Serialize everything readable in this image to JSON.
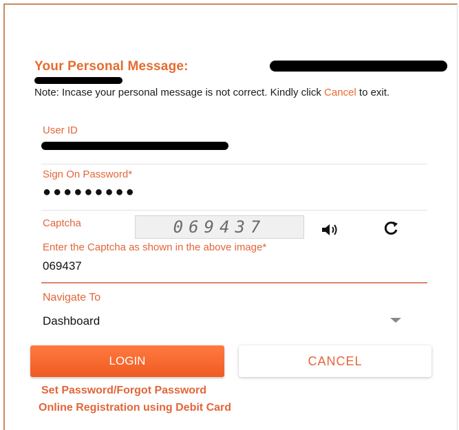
{
  "message": {
    "title": "Your Personal Message:",
    "note_prefix": "Note: Incase your personal message is not correct. Kindly click ",
    "note_cancel": "Cancel",
    "note_suffix": " to exit."
  },
  "form": {
    "user_id_label": "User ID",
    "password_label": "Sign On Password*",
    "password_mask": "●●●●●●●●●",
    "captcha_label": "Captcha",
    "captcha_image_text": "069437",
    "captcha_hint": "Enter the Captcha as shown in the above image*",
    "captcha_value": "069437",
    "navigate_label": "Navigate To",
    "navigate_value": "Dashboard"
  },
  "buttons": {
    "login": "LOGIN",
    "cancel": "CANCEL"
  },
  "links": {
    "forgot_password": "Set Password/Forgot Password",
    "online_registration": "Online Registration using Debit Card"
  },
  "colors": {
    "accent": "#e2653a",
    "login_bg": "#ef5b22"
  },
  "icons": {
    "audio": "speaker-icon",
    "refresh": "refresh-icon"
  }
}
